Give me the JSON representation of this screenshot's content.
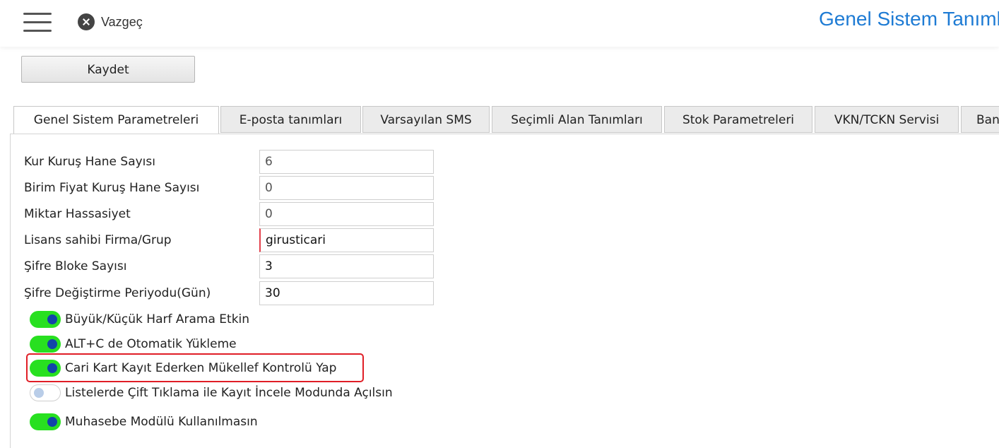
{
  "header": {
    "cancel_label": "Vazgeç",
    "title": "Genel Sistem Tanımları"
  },
  "toolbar": {
    "save_label": "Kaydet"
  },
  "tabs": [
    {
      "label": "Genel Sistem Parametreleri",
      "active": true
    },
    {
      "label": "E-posta tanımları",
      "active": false
    },
    {
      "label": "Varsayılan SMS",
      "active": false
    },
    {
      "label": "Seçimli Alan Tanımları",
      "active": false
    },
    {
      "label": "Stok Parametreleri",
      "active": false
    },
    {
      "label": "VKN/TCKN Servisi",
      "active": false
    },
    {
      "label": "Banka",
      "active": false
    }
  ],
  "fields": [
    {
      "label": "Kur Kuruş Hane Sayısı",
      "value": "6"
    },
    {
      "label": "Birim Fiyat Kuruş Hane Sayısı",
      "value": "0"
    },
    {
      "label": "Miktar Hassasiyet",
      "value": "0"
    },
    {
      "label": "Lisans sahibi Firma/Grup",
      "value": "girusticari"
    },
    {
      "label": "Şifre Bloke Sayısı",
      "value": "3"
    },
    {
      "label": "Şifre Değiştirme Periyodu(Gün)",
      "value": "30"
    }
  ],
  "toggles": [
    {
      "label": "Büyük/Küçük Harf Arama Etkin",
      "on": true
    },
    {
      "label": "ALT+C de Otomatik Yükleme",
      "on": true
    },
    {
      "label": "Cari Kart Kayıt Ederken Mükellef Kontrolü Yap",
      "on": true
    },
    {
      "label": "Listelerde Çift Tıklama ile Kayıt İncele Modunda Açılsın",
      "on": false
    },
    {
      "label": "Muhasebe Modülü Kullanılmasın",
      "on": true
    }
  ],
  "colors": {
    "title": "#1e7bd4",
    "toggle_on": "#28e020",
    "knob": "#1244a8",
    "highlight": "#e01e26",
    "required_marker": "#e3414c"
  }
}
